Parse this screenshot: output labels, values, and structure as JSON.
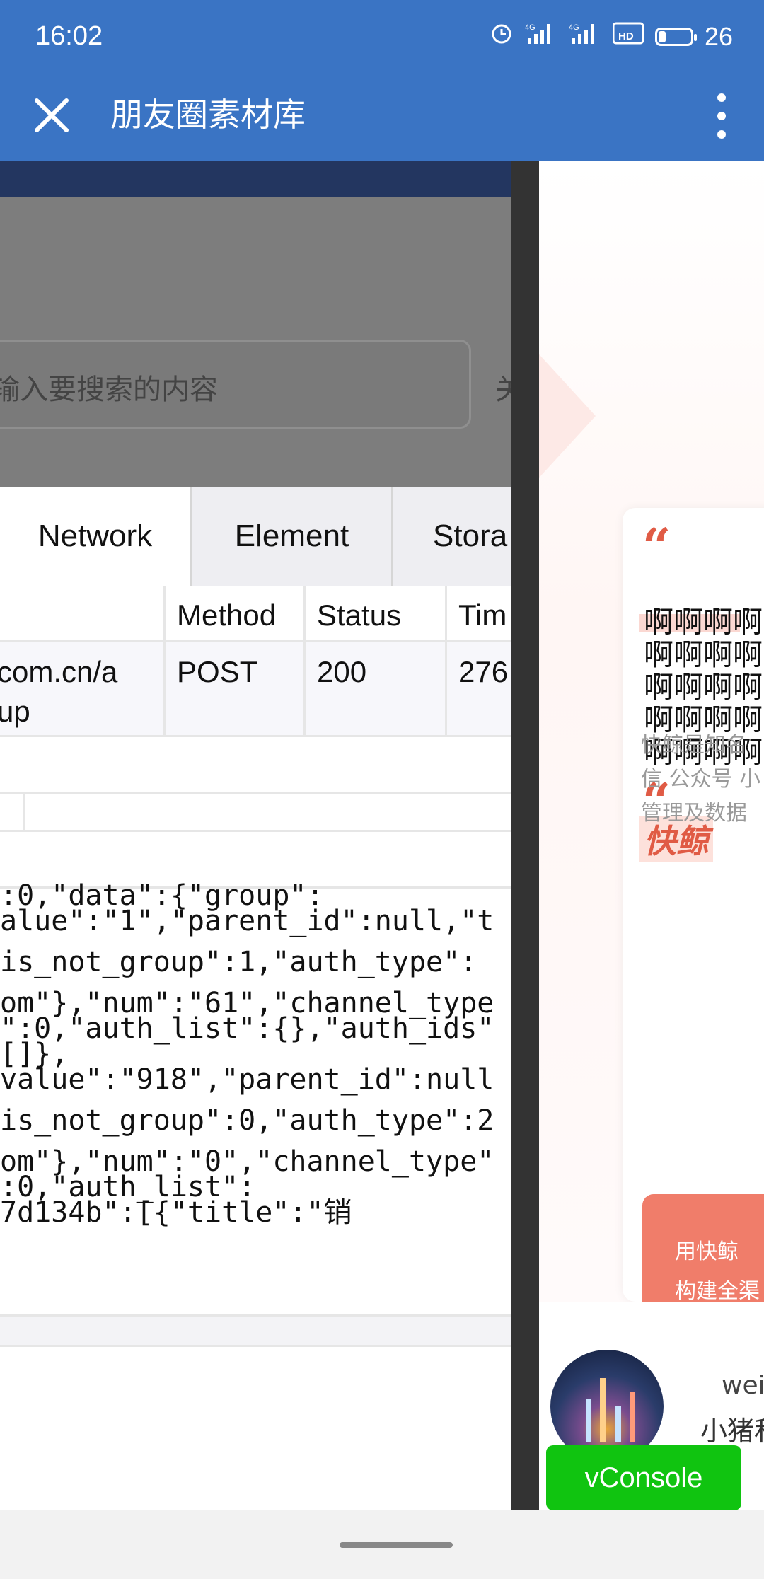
{
  "status_bar": {
    "time": "16:02",
    "signal1": "4G",
    "signal2": "4G",
    "hd": "HD",
    "battery": "26"
  },
  "title_bar": {
    "title": "朋友圈素材库"
  },
  "devtools": {
    "search": {
      "placeholder": "输入要搜索的内容",
      "button": "关"
    },
    "tabs": [
      {
        "label": "Network"
      },
      {
        "label": "Element"
      },
      {
        "label": "Stora"
      }
    ],
    "table": {
      "headers": [
        "",
        "Method",
        "Status",
        "Tim"
      ],
      "row": [
        "com.cn/a\nup",
        "POST",
        "200",
        "276"
      ]
    },
    "code_lines": [
      ":0,\"data\":{\"group\":",
      "alue\":\"1\",\"parent_id\":null,\"t",
      "",
      "is_not_group\":1,\"auth_type\":",
      "",
      "om\"},\"num\":\"61\",\"channel_type",
      "\":0,\"auth_list\":{},\"auth_ids\"",
      "[]},",
      "value\":\"918\",\"parent_id\":null",
      "",
      "is_not_group\":0,\"auth_type\":2",
      "",
      "om\"},\"num\":\"0\",\"channel_type\"",
      ":0,\"auth_list\":",
      "7d134b\":[{\"title\":\"销"
    ]
  },
  "page": {
    "quote_mark": "“",
    "ah_lines": [
      "啊啊啊啊",
      "啊啊啊啊",
      "啊啊啊啊",
      "啊啊啊啊",
      "啊啊啊啊"
    ],
    "brand": "快鲸",
    "desc_lines": [
      "快鲸是知名",
      "信 公众号 小",
      "管理及数据"
    ],
    "cta_lines": [
      "用快鲸",
      "构建全渠"
    ],
    "user": {
      "name": "weis",
      "sub": "小猪私"
    }
  },
  "vconsole": {
    "label": "vConsole"
  },
  "colors": {
    "brand_blue": "#3a74c4",
    "accent_red": "#e05b45",
    "vconsole_green": "#10c410"
  }
}
